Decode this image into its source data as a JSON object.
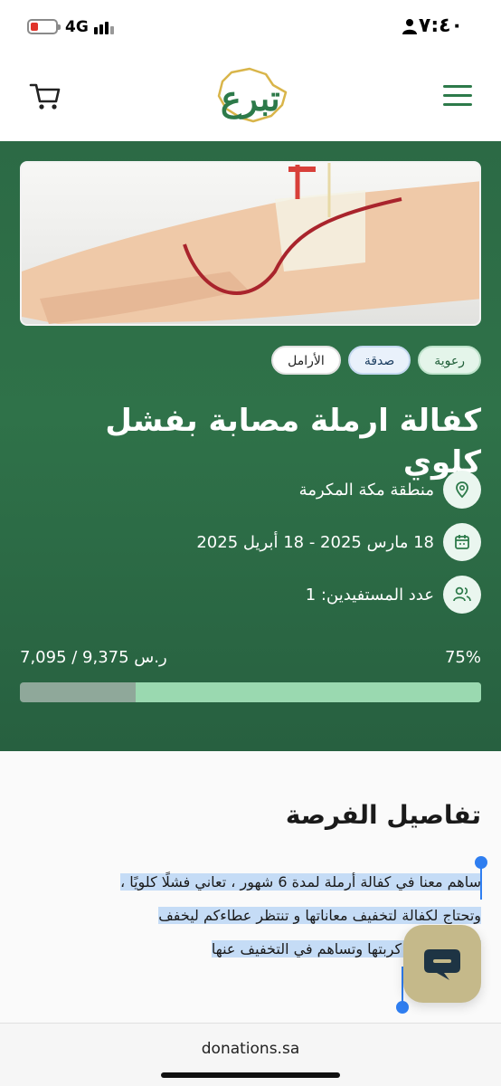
{
  "status_bar": {
    "time": "٧:٤٠",
    "network": "4G"
  },
  "header": {
    "logo_text": "تبرع"
  },
  "campaign": {
    "tags": [
      "رعوية",
      "صدقة",
      "الأرامل"
    ],
    "title": "كفالة ارملة مصابة بفشل كلوي",
    "location": "منطقة مكة المكرمة",
    "dates": "18 مارس 2025 - 18 أبريل 2025",
    "beneficiaries": "عدد المستفيدين: 1",
    "progress_percent": "75%",
    "progress_value": 0.75,
    "amount": "7,095 / 9,375 ر.س"
  },
  "details": {
    "title": "تفاصيل الفرصة",
    "lines": [
      "ساهم معنا في كفالة أرملة لمدة 6 شهور ، تعاني فشلًا كلويًا ،",
      "وتحتاج لكفالة لتخفيف معاناتها و تنتظر عطاءكم ليخفف",
      "بتبرعك تفرّج كربتها وتساهم في التخفيف عنها"
    ]
  },
  "url_bar": {
    "url": "donations.sa"
  },
  "colors": {
    "brand_green": "#2d7a4a",
    "progress_fill": "#9ad9b0",
    "chat_button": "#c5b98a"
  }
}
